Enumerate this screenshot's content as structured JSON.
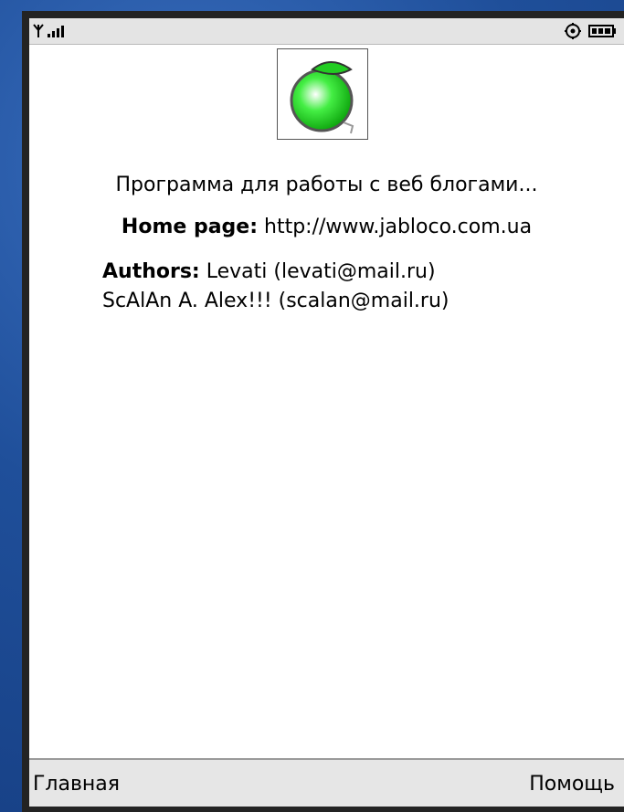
{
  "about": {
    "description": "Программа для работы с веб блогами...",
    "homepage_label": "Home page:",
    "homepage_url": "http://www.jabloco.com.ua",
    "authors_label": "Authors:",
    "author_1": "Levati (levati@mail.ru)",
    "author_2": "ScAlAn A. Alex!!! (scalan@mail.ru)"
  },
  "softkeys": {
    "left": "Главная",
    "right": "Помощь"
  },
  "status_bar": {
    "icons": [
      "signal-icon",
      "settings-icon",
      "battery-icon"
    ]
  },
  "colors": {
    "background": "#1f4f9a",
    "status_bar": "#e4e4e4",
    "softkey_bar": "#e6e6e6",
    "app_icon_green": "#33dd33"
  }
}
